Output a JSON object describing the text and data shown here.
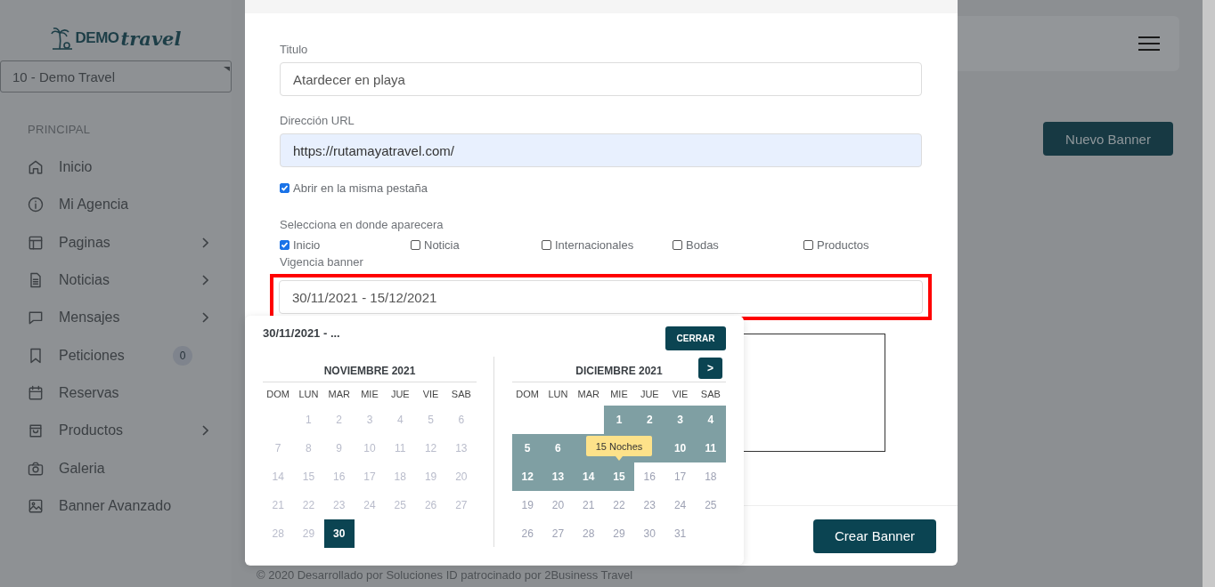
{
  "sidebar": {
    "logo": {
      "word_1": "DEMO",
      "word_2": "travel"
    },
    "agency_select": "10 - Demo Travel",
    "section_title": "PRINCIPAL",
    "items": [
      {
        "label": "Inicio",
        "submenu": false
      },
      {
        "label": "Mi Agencia",
        "submenu": false
      },
      {
        "label": "Paginas",
        "submenu": true
      },
      {
        "label": "Noticias",
        "submenu": true
      },
      {
        "label": "Mensajes",
        "submenu": true
      },
      {
        "label": "Peticiones",
        "submenu": false,
        "badge": "0"
      },
      {
        "label": "Reservas",
        "submenu": false
      },
      {
        "label": "Productos",
        "submenu": true
      },
      {
        "label": "Galeria",
        "submenu": false
      },
      {
        "label": "Banner Avanzado",
        "submenu": false
      }
    ]
  },
  "page": {
    "new_button": "Nuevo Banner",
    "footer": "© 2020 Desarrollado por Soluciones ID patrocinado por 2Business Travel"
  },
  "modal": {
    "fields": [
      {
        "label": "Titulo",
        "value": "Atardecer en playa",
        "autofilled": false
      },
      {
        "label": "Dirección URL",
        "value": "https://rutamayatravel.com/",
        "autofilled": true
      }
    ],
    "open_same_tab": {
      "label": "Abrir en la misma pestaña",
      "checked": true
    },
    "placement": {
      "label": "Selecciona en donde aparecera",
      "options": [
        {
          "label": "Inicio",
          "checked": true
        },
        {
          "label": "Noticia",
          "checked": false
        },
        {
          "label": "Internacionales",
          "checked": false
        },
        {
          "label": "Bodas",
          "checked": false
        },
        {
          "label": "Productos",
          "checked": false
        }
      ]
    },
    "validity": {
      "label": "Vigencia banner",
      "value": "30/11/2021 - 15/12/2021",
      "highlighted": true
    },
    "submit": "Crear Banner"
  },
  "date_picker": {
    "summary": "30/11/2021 - ...",
    "close_button": "CERRAR",
    "next_button": ">",
    "tooltip": "15 Noches",
    "months": [
      {
        "title": "NOVIEMBRE 2021",
        "weekdays": [
          "DOM",
          "LUN",
          "MAR",
          "MIE",
          "JUE",
          "VIE",
          "SAB"
        ],
        "days": [
          {
            "kind": "blank"
          },
          {
            "kind": "day",
            "label": "1",
            "disabled": true,
            "in_range": false,
            "selected": false
          },
          {
            "kind": "day",
            "label": "2",
            "disabled": true,
            "in_range": false,
            "selected": false
          },
          {
            "kind": "day",
            "label": "3",
            "disabled": true,
            "in_range": false,
            "selected": false
          },
          {
            "kind": "day",
            "label": "4",
            "disabled": true,
            "in_range": false,
            "selected": false
          },
          {
            "kind": "day",
            "label": "5",
            "disabled": true,
            "in_range": false,
            "selected": false
          },
          {
            "kind": "day",
            "label": "6",
            "disabled": true,
            "in_range": false,
            "selected": false
          },
          {
            "kind": "day",
            "label": "7",
            "disabled": true,
            "in_range": false,
            "selected": false
          },
          {
            "kind": "day",
            "label": "8",
            "disabled": true,
            "in_range": false,
            "selected": false
          },
          {
            "kind": "day",
            "label": "9",
            "disabled": true,
            "in_range": false,
            "selected": false
          },
          {
            "kind": "day",
            "label": "10",
            "disabled": true,
            "in_range": false,
            "selected": false
          },
          {
            "kind": "day",
            "label": "11",
            "disabled": true,
            "in_range": false,
            "selected": false
          },
          {
            "kind": "day",
            "label": "12",
            "disabled": true,
            "in_range": false,
            "selected": false
          },
          {
            "kind": "day",
            "label": "13",
            "disabled": true,
            "in_range": false,
            "selected": false
          },
          {
            "kind": "day",
            "label": "14",
            "disabled": true,
            "in_range": false,
            "selected": false
          },
          {
            "kind": "day",
            "label": "15",
            "disabled": true,
            "in_range": false,
            "selected": false
          },
          {
            "kind": "day",
            "label": "16",
            "disabled": true,
            "in_range": false,
            "selected": false
          },
          {
            "kind": "day",
            "label": "17",
            "disabled": true,
            "in_range": false,
            "selected": false
          },
          {
            "kind": "day",
            "label": "18",
            "disabled": true,
            "in_range": false,
            "selected": false
          },
          {
            "kind": "day",
            "label": "19",
            "disabled": true,
            "in_range": false,
            "selected": false
          },
          {
            "kind": "day",
            "label": "20",
            "disabled": true,
            "in_range": false,
            "selected": false
          },
          {
            "kind": "day",
            "label": "21",
            "disabled": true,
            "in_range": false,
            "selected": false
          },
          {
            "kind": "day",
            "label": "22",
            "disabled": true,
            "in_range": false,
            "selected": false
          },
          {
            "kind": "day",
            "label": "23",
            "disabled": true,
            "in_range": false,
            "selected": false
          },
          {
            "kind": "day",
            "label": "24",
            "disabled": true,
            "in_range": false,
            "selected": false
          },
          {
            "kind": "day",
            "label": "25",
            "disabled": true,
            "in_range": false,
            "selected": false
          },
          {
            "kind": "day",
            "label": "26",
            "disabled": true,
            "in_range": false,
            "selected": false
          },
          {
            "kind": "day",
            "label": "27",
            "disabled": true,
            "in_range": false,
            "selected": false
          },
          {
            "kind": "day",
            "label": "28",
            "disabled": true,
            "in_range": false,
            "selected": false
          },
          {
            "kind": "day",
            "label": "29",
            "disabled": true,
            "in_range": false,
            "selected": false
          },
          {
            "kind": "day",
            "label": "30",
            "disabled": false,
            "in_range": false,
            "selected": true
          }
        ]
      },
      {
        "title": "DICIEMBRE 2021",
        "weekdays": [
          "DOM",
          "LUN",
          "MAR",
          "MIE",
          "JUE",
          "VIE",
          "SAB"
        ],
        "days": [
          {
            "kind": "blank"
          },
          {
            "kind": "blank"
          },
          {
            "kind": "blank"
          },
          {
            "kind": "day",
            "label": "1",
            "disabled": false,
            "in_range": true,
            "selected": false
          },
          {
            "kind": "day",
            "label": "2",
            "disabled": false,
            "in_range": true,
            "selected": false
          },
          {
            "kind": "day",
            "label": "3",
            "disabled": false,
            "in_range": true,
            "selected": false
          },
          {
            "kind": "day",
            "label": "4",
            "disabled": false,
            "in_range": true,
            "selected": false
          },
          {
            "kind": "day",
            "label": "5",
            "disabled": false,
            "in_range": true,
            "selected": false
          },
          {
            "kind": "day",
            "label": "6",
            "disabled": false,
            "in_range": true,
            "selected": false
          },
          {
            "kind": "covered",
            "in_range": true
          },
          {
            "kind": "covered",
            "in_range": true
          },
          {
            "kind": "covered",
            "in_range": true
          },
          {
            "kind": "day",
            "label": "10",
            "disabled": false,
            "in_range": true,
            "selected": false
          },
          {
            "kind": "day",
            "label": "11",
            "disabled": false,
            "in_range": true,
            "selected": false
          },
          {
            "kind": "day",
            "label": "12",
            "disabled": false,
            "in_range": true,
            "selected": false
          },
          {
            "kind": "day",
            "label": "13",
            "disabled": false,
            "in_range": true,
            "selected": false
          },
          {
            "kind": "day",
            "label": "14",
            "disabled": false,
            "in_range": true,
            "selected": false
          },
          {
            "kind": "day",
            "label": "15",
            "disabled": false,
            "in_range": true,
            "selected": false
          },
          {
            "kind": "day",
            "label": "16",
            "disabled": false,
            "in_range": false,
            "selected": false
          },
          {
            "kind": "day",
            "label": "17",
            "disabled": false,
            "in_range": false,
            "selected": false
          },
          {
            "kind": "day",
            "label": "18",
            "disabled": false,
            "in_range": false,
            "selected": false
          },
          {
            "kind": "day",
            "label": "19",
            "disabled": false,
            "in_range": false,
            "selected": false
          },
          {
            "kind": "day",
            "label": "20",
            "disabled": false,
            "in_range": false,
            "selected": false
          },
          {
            "kind": "day",
            "label": "21",
            "disabled": false,
            "in_range": false,
            "selected": false
          },
          {
            "kind": "day",
            "label": "22",
            "disabled": false,
            "in_range": false,
            "selected": false
          },
          {
            "kind": "day",
            "label": "23",
            "disabled": false,
            "in_range": false,
            "selected": false
          },
          {
            "kind": "day",
            "label": "24",
            "disabled": false,
            "in_range": false,
            "selected": false
          },
          {
            "kind": "day",
            "label": "25",
            "disabled": false,
            "in_range": false,
            "selected": false
          },
          {
            "kind": "day",
            "label": "26",
            "disabled": false,
            "in_range": false,
            "selected": false
          },
          {
            "kind": "day",
            "label": "27",
            "disabled": false,
            "in_range": false,
            "selected": false
          },
          {
            "kind": "day",
            "label": "28",
            "disabled": false,
            "in_range": false,
            "selected": false
          },
          {
            "kind": "day",
            "label": "29",
            "disabled": false,
            "in_range": false,
            "selected": false
          },
          {
            "kind": "day",
            "label": "30",
            "disabled": false,
            "in_range": false,
            "selected": false
          },
          {
            "kind": "day",
            "label": "31",
            "disabled": false,
            "in_range": false,
            "selected": false
          }
        ]
      }
    ]
  }
}
